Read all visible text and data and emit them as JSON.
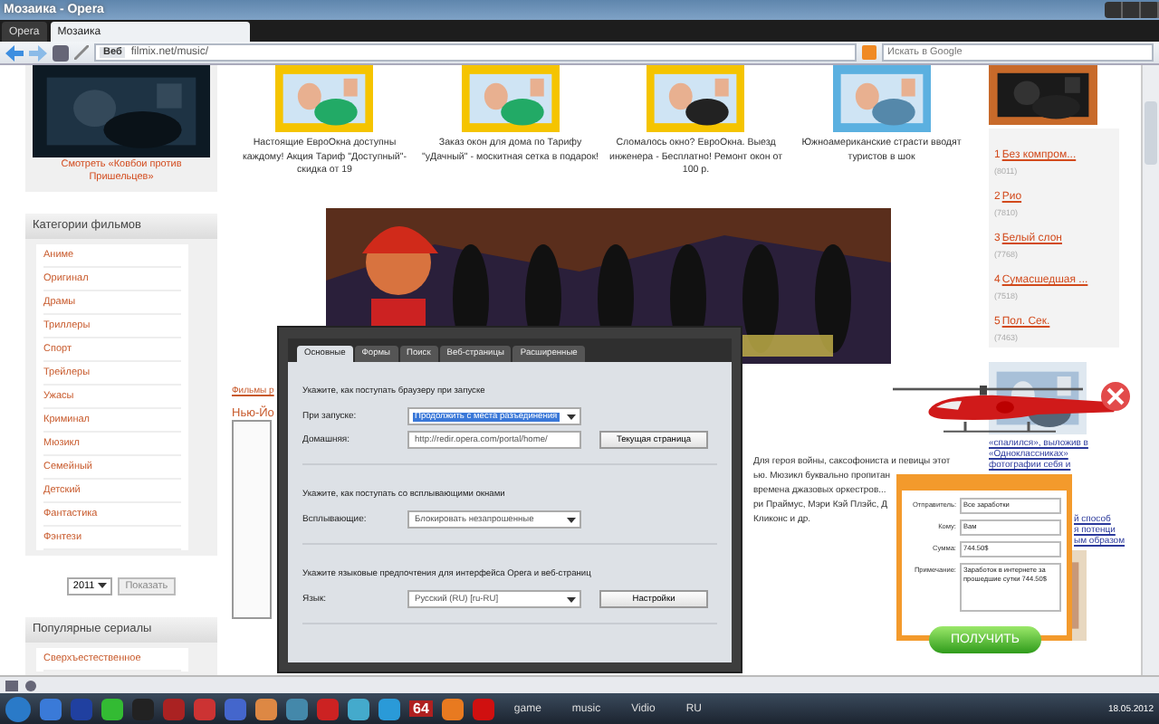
{
  "window": {
    "title": "Мозаика - Opera"
  },
  "tabs": [
    {
      "label": "Opera",
      "selected": false
    },
    {
      "label": "Мозаика",
      "selected": true
    }
  ],
  "address_bar": {
    "badge": "Веб",
    "url": "filmix.net/music/"
  },
  "search": {
    "placeholder": "Искать в Google"
  },
  "promo": {
    "caption": "Смотреть «Ковбои против Пришельцев»"
  },
  "categories": {
    "title": "Категории фильмов",
    "items": [
      "Аниме",
      "Оригинал",
      "Драмы",
      "Триллеры",
      "Спорт",
      "Трейлеры",
      "Ужасы",
      "Криминал",
      "Мюзикл",
      "Семейный",
      "Детский",
      "Фантастика",
      "Фэнтези"
    ]
  },
  "year_filter": {
    "value": "2011",
    "button": "Показать"
  },
  "series": {
    "title": "Популярные сериалы",
    "items": [
      "Сверхъестественное"
    ]
  },
  "ads": [
    "Настоящие ЕвроОкна доступны каждому! Акция Тариф \"Доступный\"- скидка от 19",
    "Заказ окон для дома по Тарифу \"уДачный\" - москитная сетка в подарок!",
    "Сломалось окно? ЕвроОкна. Выезд инженера - Бесплатно! Ремонт окон от 100 р.",
    "Южноамериканские страсти вводят туристов в шок"
  ],
  "article": {
    "link": "Фильмы р",
    "title": "Нью-Йо",
    "lines": [
      "Для героя войны, саксофониста и певицы этот",
      "ью. Мюзикл буквально пропитан",
      "времена джазовых оркестров...",
      "ри Праймус, Мэри Кэй Плэйс, Д",
      "Кликонс и др."
    ]
  },
  "top_list": [
    {
      "rank": "1",
      "title": "Без компром...",
      "count": "(8011)"
    },
    {
      "rank": "2",
      "title": "Рио",
      "count": "(7810)"
    },
    {
      "rank": "3",
      "title": "Белый слон",
      "count": "(7768)"
    },
    {
      "rank": "4",
      "title": "Сумасшедшая ...",
      "count": "(7518)"
    },
    {
      "rank": "5",
      "title": "Пол. Сек.",
      "count": "(7463)"
    }
  ],
  "news_links": [
    {
      "lines": [
        "«спалился», выложив в",
        "«Одноклассниках»",
        "фотографии себя и"
      ]
    },
    {
      "lines": [
        "й способ",
        "я потенци",
        "ым образом"
      ]
    }
  ],
  "settings_dialog": {
    "tabs": [
      {
        "label": "Основные",
        "selected": true
      },
      {
        "label": "Формы",
        "selected": false
      },
      {
        "label": "Поиск",
        "selected": false
      },
      {
        "label": "Веб-страницы",
        "selected": false
      },
      {
        "label": "Расширенные",
        "selected": false
      }
    ],
    "sections": [
      {
        "heading": "Укажите, как поступать браузеру при запуске",
        "rows": [
          {
            "label": "При запуске:",
            "kind": "select",
            "value": "Продолжить с места разъединения",
            "focused": true
          },
          {
            "label": "Домашняя:",
            "kind": "input",
            "value": "http://redir.opera.com/portal/home/",
            "button": "Текущая страница"
          }
        ]
      },
      {
        "heading": "Укажите, как поступать со всплывающими окнами",
        "rows": [
          {
            "label": "Всплывающие:",
            "kind": "select",
            "value": "Блокировать незапрошенные",
            "focused": false
          }
        ]
      },
      {
        "heading": "Укажите языковые предпочтения для интерфейса Opera и веб-страниц",
        "rows": [
          {
            "label": "Язык:",
            "kind": "select",
            "value": "Русский (RU) [ru-RU]",
            "focused": false,
            "button": "Настройки"
          }
        ]
      }
    ]
  },
  "payment_popup": {
    "fields": [
      {
        "label": "Отправитель:",
        "value": "Все заработки",
        "kind": "input"
      },
      {
        "label": "Кому:",
        "value": "Вам",
        "kind": "input"
      },
      {
        "label": "Сумма:",
        "value": "744.50$",
        "kind": "input"
      },
      {
        "label": "Примечание:",
        "value": "Заработок в интернете за прошедшие сутки 744.50$",
        "kind": "note"
      }
    ],
    "button": "ПОЛУЧИТЬ"
  },
  "taskbar": {
    "badge": "64",
    "labels": [
      "game",
      "music",
      "Vidio"
    ],
    "language": "RU",
    "clock": "18.05.2012"
  }
}
